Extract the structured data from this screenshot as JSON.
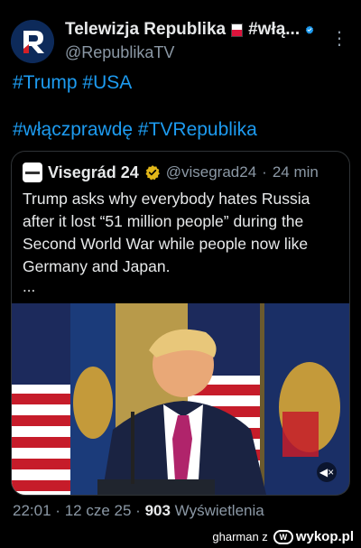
{
  "post": {
    "author_name": "Telewizja Republika",
    "author_suffix": "#włą...",
    "handle": "@RepublikaTV",
    "hashtags_line1": "#Trump #USA",
    "hashtags_line2": "#włączprawdę #TVRepublika"
  },
  "quote": {
    "name": "Visegrád 24",
    "handle": "@visegrad24",
    "separator": "·",
    "time": "24 min",
    "text": "Trump asks why everybody hates Russia after it lost “51 million people” during the Second World War while people now like Germany and Japan.",
    "ellipsis": "..."
  },
  "meta": {
    "time": "22:01",
    "sep1": "·",
    "date": "12 cze 25",
    "sep2": "·",
    "views": "903",
    "views_label": "Wyświetlenia"
  },
  "footer": {
    "user": "gharman z",
    "site": "wykop.pl"
  },
  "colors": {
    "link": "#1d9bf0",
    "muted": "#8b98a5",
    "verified_blue": "#1d9bf0",
    "verified_gold": "#e2b719"
  }
}
